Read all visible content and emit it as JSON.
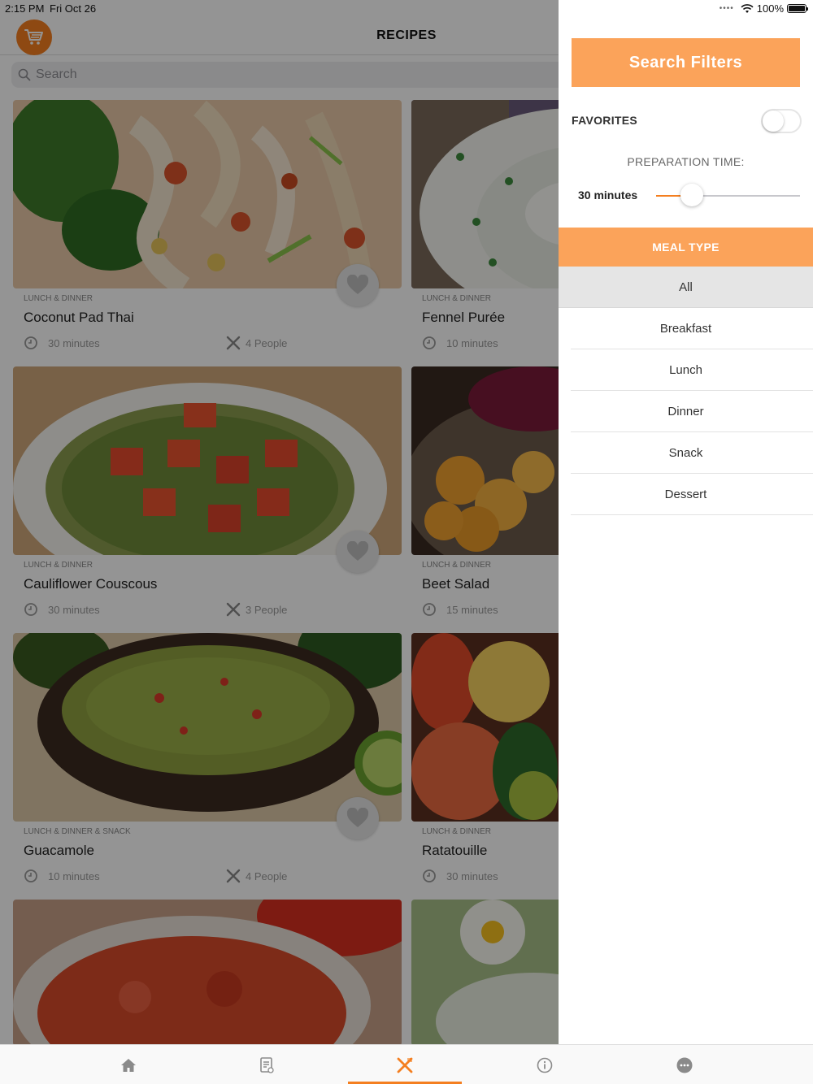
{
  "status_bar": {
    "time": "2:15 PM",
    "date": "Fri Oct 26",
    "battery": "100%"
  },
  "nav": {
    "title": "RECIPES"
  },
  "search": {
    "placeholder": "Search"
  },
  "recipes": [
    {
      "category": "LUNCH & DINNER",
      "title": "Coconut Pad Thai",
      "time": "30 minutes",
      "people": "4 People"
    },
    {
      "category": "LUNCH & DINNER",
      "title": "Fennel Purée",
      "time": "10 minutes",
      "people": ""
    },
    {
      "category": "LUNCH & DINNER",
      "title": "Cauliflower Couscous",
      "time": "30 minutes",
      "people": "3 People"
    },
    {
      "category": "LUNCH & DINNER",
      "title": "Beet Salad",
      "time": "15 minutes",
      "people": ""
    },
    {
      "category": "LUNCH & DINNER & SNACK",
      "title": "Guacamole",
      "time": "10 minutes",
      "people": "4 People"
    },
    {
      "category": "LUNCH & DINNER",
      "title": "Ratatouille",
      "time": "30 minutes",
      "people": ""
    }
  ],
  "filters": {
    "button_label": "Search Filters",
    "favorites_label": "FAVORITES",
    "favorites_on": false,
    "prep_label": "PREPARATION TIME:",
    "prep_value": "30 minutes",
    "prep_level": 0.25,
    "meal_type_label": "MEAL TYPE",
    "meal_types": [
      "All",
      "Breakfast",
      "Lunch",
      "Dinner",
      "Snack",
      "Dessert"
    ],
    "selected_meal_type": "All"
  },
  "tabs": [
    "home-icon",
    "shopping-list-icon",
    "recipes-icon",
    "info-icon",
    "more-icon"
  ],
  "active_tab": 2,
  "colors": {
    "accent": "#f47f20",
    "panel_accent": "#fba35a",
    "selected_row": "#e5e5e5"
  }
}
